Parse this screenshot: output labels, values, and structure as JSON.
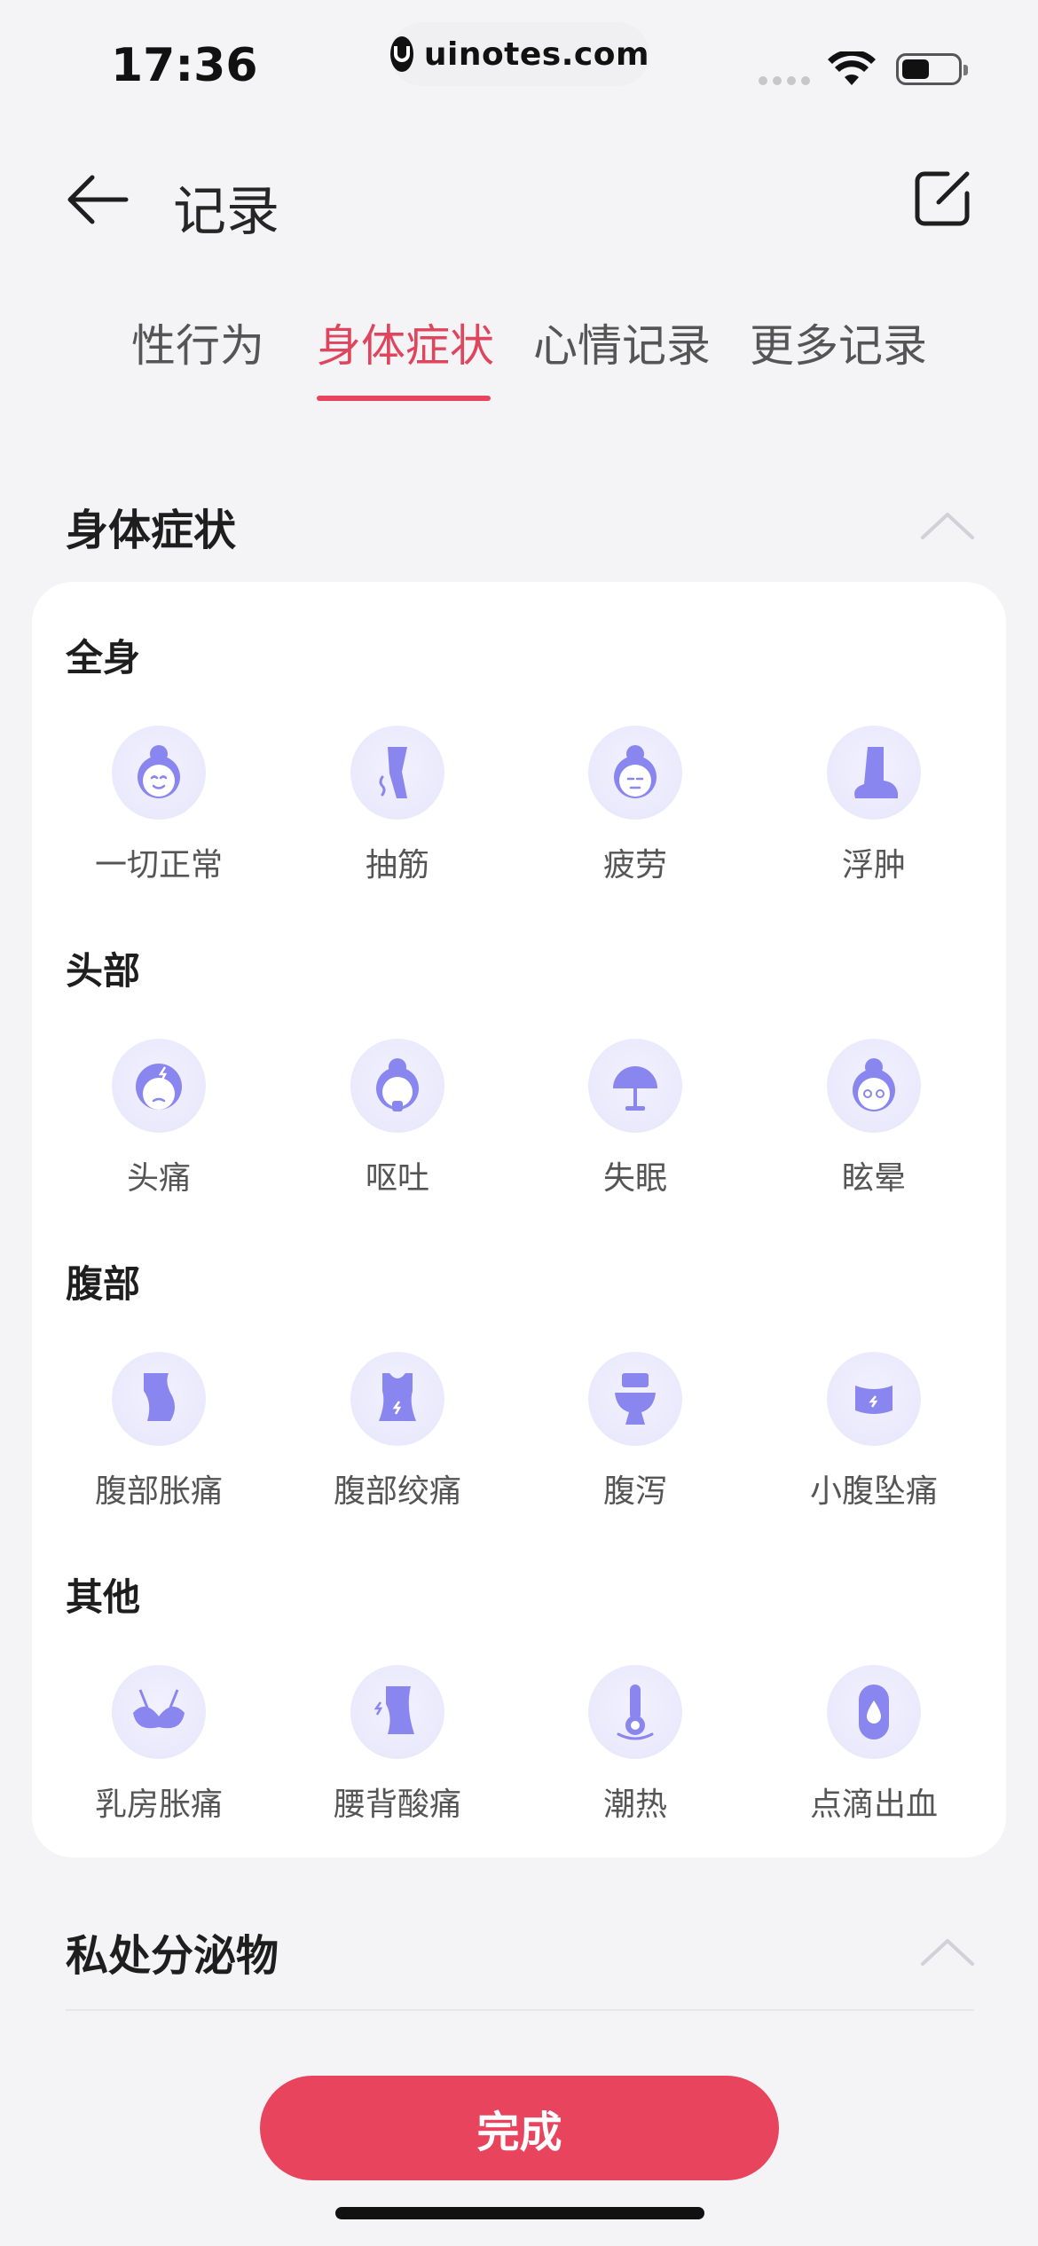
{
  "status_bar": {
    "time": "17:36",
    "url": "uinotes.com"
  },
  "header": {
    "title": "记录"
  },
  "tabs": [
    {
      "label": "性行为",
      "active": false
    },
    {
      "label": "身体症状",
      "active": true
    },
    {
      "label": "心情记录",
      "active": false
    },
    {
      "label": "更多记录",
      "active": false
    }
  ],
  "symptoms_section": {
    "title": "身体症状",
    "groups": [
      {
        "title": "全身",
        "items": [
          {
            "label": "一切正常",
            "icon": "smiling-face-icon"
          },
          {
            "label": "抽筋",
            "icon": "leg-cramp-icon"
          },
          {
            "label": "疲劳",
            "icon": "tired-face-icon"
          },
          {
            "label": "浮肿",
            "icon": "swollen-foot-icon"
          }
        ]
      },
      {
        "title": "头部",
        "items": [
          {
            "label": "头痛",
            "icon": "headache-icon"
          },
          {
            "label": "呕吐",
            "icon": "vomit-icon"
          },
          {
            "label": "失眠",
            "icon": "lamp-icon"
          },
          {
            "label": "眩晕",
            "icon": "dizzy-face-icon"
          }
        ]
      },
      {
        "title": "腹部",
        "items": [
          {
            "label": "腹部胀痛",
            "icon": "bloated-belly-icon"
          },
          {
            "label": "腹部绞痛",
            "icon": "cramp-belly-icon"
          },
          {
            "label": "腹泻",
            "icon": "toilet-icon"
          },
          {
            "label": "小腹坠痛",
            "icon": "lower-belly-icon"
          }
        ]
      },
      {
        "title": "其他",
        "items": [
          {
            "label": "乳房胀痛",
            "icon": "bra-icon"
          },
          {
            "label": "腰背酸痛",
            "icon": "back-pain-icon"
          },
          {
            "label": "潮热",
            "icon": "thermometer-icon"
          },
          {
            "label": "点滴出血",
            "icon": "pad-drop-icon"
          }
        ]
      }
    ]
  },
  "discharge_section": {
    "title": "私处分泌物"
  },
  "footer": {
    "done_label": "完成"
  },
  "colors": {
    "accent": "#e8445d",
    "icon_fill": "#8a86ef",
    "icon_bg": "#ebeaff"
  }
}
